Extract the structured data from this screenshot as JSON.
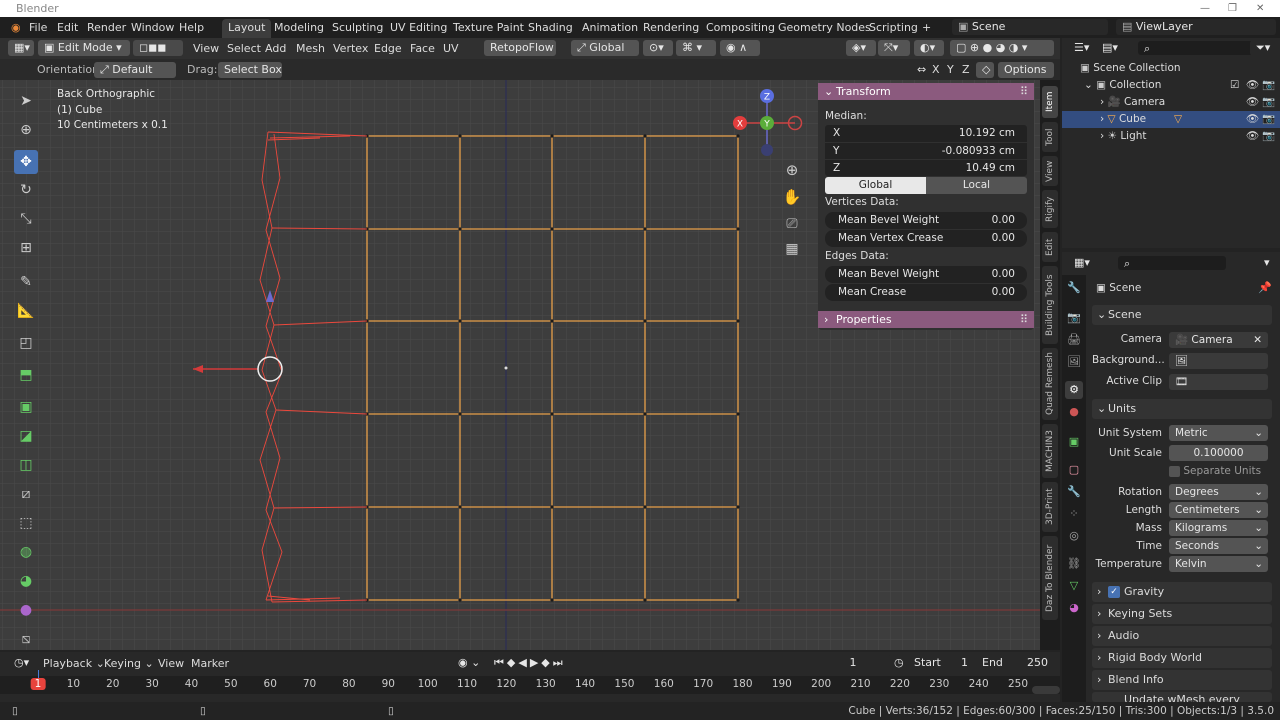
{
  "window": {
    "title": "Blender"
  },
  "menu": [
    "File",
    "Edit",
    "Render",
    "Window",
    "Help"
  ],
  "workspaces": [
    "Layout",
    "Modeling",
    "Sculpting",
    "UV Editing",
    "Texture Paint",
    "Shading",
    "Animation",
    "Rendering",
    "Compositing",
    "Geometry Nodes",
    "Scripting",
    "+"
  ],
  "scene": {
    "label": "Scene",
    "viewlayer": "ViewLayer"
  },
  "vp_header": {
    "mode": "Edit Mode",
    "menus": [
      "View",
      "Select",
      "Add",
      "Mesh",
      "Vertex",
      "Edge",
      "Face",
      "UV"
    ],
    "retopo": "RetopoFlow",
    "transform_orientation": "Global"
  },
  "vp_tool": {
    "orientation_label": "Orientation:",
    "orientation": "Default",
    "drag_label": "Drag:",
    "drag": "Select Box",
    "xyz": [
      "X",
      "Y",
      "Z"
    ],
    "options": "Options"
  },
  "viewport_info": {
    "view": "Back Orthographic",
    "object": "(1) Cube",
    "scale": "10 Centimeters x 0.1"
  },
  "gizmo": {
    "x": "X",
    "y": "Y",
    "z": "Z"
  },
  "npanel": {
    "title": "Transform",
    "median": "Median:",
    "x_label": "X",
    "x": "10.192 cm",
    "y_label": "Y",
    "y": "-0.080933 cm",
    "z_label": "Z",
    "z": "10.49 cm",
    "global": "Global",
    "local": "Local",
    "vertices_data": "Vertices Data:",
    "mean_bevel_weight": "Mean Bevel Weight",
    "mean_bevel_weight_val": "0.00",
    "mean_vertex_crease": "Mean Vertex Crease",
    "mean_vertex_crease_val": "0.00",
    "edges_data": "Edges Data:",
    "edge_bevel_weight": "Mean Bevel Weight",
    "edge_bevel_weight_val": "0.00",
    "mean_crease": "Mean Crease",
    "mean_crease_val": "0.00",
    "properties": "Properties"
  },
  "side_tabs": [
    "Item",
    "Tool",
    "View",
    "Rigify",
    "Edit",
    "Building Tools",
    "Quad Remesh",
    "MACHIN3",
    "3D-Print",
    "Daz To Blender"
  ],
  "outliner": {
    "scene_collection": "Scene Collection",
    "collection": "Collection",
    "items": [
      "Camera",
      "Cube",
      "Light"
    ]
  },
  "properties": {
    "header": "Scene",
    "scene_section": "Scene",
    "camera_label": "Camera",
    "camera": "Camera",
    "background_label": "Background...",
    "active_clip_label": "Active Clip",
    "units_section": "Units",
    "unit_system_label": "Unit System",
    "unit_system": "Metric",
    "unit_scale_label": "Unit Scale",
    "unit_scale": "0.100000",
    "separate_units": "Separate Units",
    "rotation_label": "Rotation",
    "rotation": "Degrees",
    "length_label": "Length",
    "length": "Centimeters",
    "mass_label": "Mass",
    "mass": "Kilograms",
    "time_label": "Time",
    "time": "Seconds",
    "temperature_label": "Temperature",
    "temperature": "Kelvin",
    "sections": [
      "Gravity",
      "Keying Sets",
      "Audio",
      "Rigid Body World",
      "Blend Info"
    ],
    "last": "Update wMesh every frame"
  },
  "timeline": {
    "menus": [
      "Playback",
      "Keying",
      "View",
      "Marker"
    ],
    "current_frame": "1",
    "start_label": "Start",
    "start": "1",
    "end_label": "End",
    "end": "250",
    "ticks": [
      "1",
      "10",
      "20",
      "30",
      "40",
      "50",
      "60",
      "70",
      "80",
      "90",
      "100",
      "110",
      "120",
      "130",
      "140",
      "150",
      "160",
      "170",
      "180",
      "190",
      "200",
      "210",
      "220",
      "230",
      "240",
      "250"
    ]
  },
  "status": "Cube | Verts:36/152 | Edges:60/300 | Faces:25/150 | Tris:300 | Objects:1/3 | 3.5.0"
}
